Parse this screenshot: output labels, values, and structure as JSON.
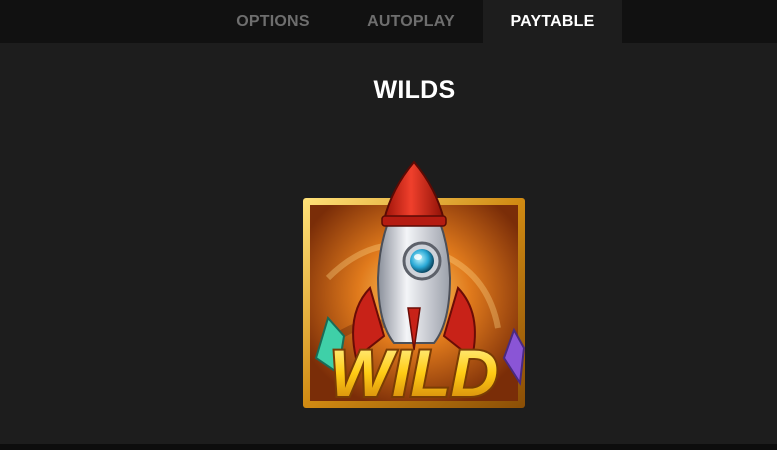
{
  "tabs": [
    {
      "label": "OPTIONS",
      "active": false
    },
    {
      "label": "AUTOPLAY",
      "active": false
    },
    {
      "label": "PAYTABLE",
      "active": true
    }
  ],
  "paytable": {
    "section_title": "WILDS",
    "symbol": {
      "name": "wild-rocket-symbol",
      "caption": "WILD"
    }
  },
  "colors": {
    "background": "#1d1d1d",
    "tabbar": "#111111",
    "tab_inactive_text": "#6e6e6e",
    "tab_active_text": "#ffffff",
    "frame_gold": "#e3a21a",
    "rocket_red": "#d62a1e",
    "wild_yellow": "#ffd21a"
  }
}
